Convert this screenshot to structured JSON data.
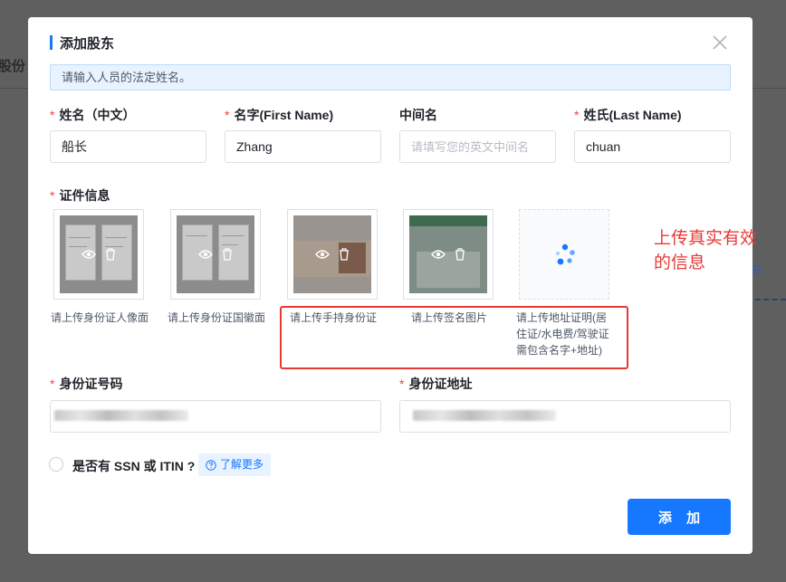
{
  "background": {
    "left_fragment": "股份",
    "right_fragment": "东"
  },
  "modal": {
    "title": "添加股东",
    "hint": "请输入人员的法定姓名。",
    "fields": {
      "chinese_name": {
        "label": "姓名（中文）",
        "required": true,
        "value": "船长"
      },
      "first_name": {
        "label": "名字(First Name)",
        "required": true,
        "value": "Zhang"
      },
      "middle_name": {
        "label": "中间名",
        "required": false,
        "value": "",
        "placeholder": "请填写您的英文中间名"
      },
      "last_name": {
        "label": "姓氏(Last Name)",
        "required": true,
        "value": "chuan"
      }
    },
    "documents": {
      "label": "证件信息",
      "required": true,
      "items": [
        {
          "caption": "请上传身份证人像面"
        },
        {
          "caption": "请上传身份证国徽面"
        },
        {
          "caption": "请上传手持身份证"
        },
        {
          "caption": "请上传签名图片"
        },
        {
          "caption": "请上传地址证明(居住证/水电费/驾驶证需包含名字+地址)"
        }
      ]
    },
    "id_number": {
      "label": "身份证号码",
      "required": true
    },
    "id_address": {
      "label": "身份证地址",
      "required": true
    },
    "ssn_question": "是否有 SSN 或 ITIN ?",
    "learn_more": "了解更多",
    "submit": "添 加"
  },
  "annotation": {
    "note": "上传真实有效的信息"
  },
  "colors": {
    "accent": "#1677ff",
    "annotation": "#e53935",
    "required": "#f53f3f"
  }
}
